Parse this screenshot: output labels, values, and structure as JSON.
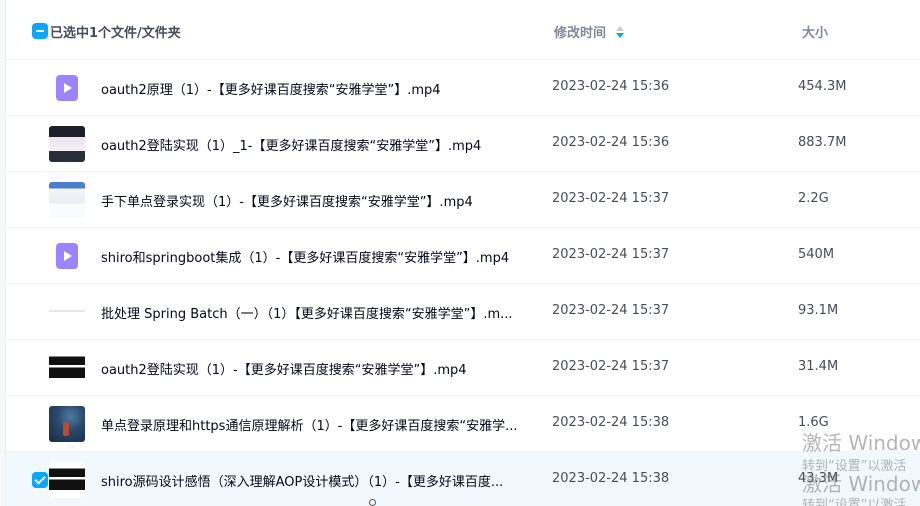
{
  "header": {
    "selected_label": "已选中1个文件/文件夹",
    "time_label": "修改时间",
    "size_label": "大小"
  },
  "rows": [
    {
      "name": "oauth2原理（1）-【更多好课百度搜索“安雅学堂”】.mp4",
      "time": "2023-02-24 15:36",
      "size": "454.3M",
      "thumb": "video-file-icon"
    },
    {
      "name": "oauth2登陆实现（1）_1-【更多好课百度搜索“安雅学堂”】.mp4",
      "time": "2023-02-24 15:36",
      "size": "883.7M",
      "thumb": "video-thumbnail"
    },
    {
      "name": "手下单点登录实现（1）-【更多好课百度搜索“安雅学堂”】.mp4",
      "time": "2023-02-24 15:37",
      "size": "2.2G",
      "thumb": "video-thumbnail"
    },
    {
      "name": "shiro和springboot集成（1）-【更多好课百度搜索“安雅学堂”】.mp4",
      "time": "2023-02-24 15:37",
      "size": "540M",
      "thumb": "video-file-icon"
    },
    {
      "name": "批处理 Spring Batch（一）（1）【更多好课百度搜索“安雅学堂”】.m...",
      "time": "2023-02-24 15:37",
      "size": "93.1M",
      "thumb": "video-thumbnail"
    },
    {
      "name": "oauth2登陆实现（1）-【更多好课百度搜索“安雅学堂”】.mp4",
      "time": "2023-02-24 15:37",
      "size": "31.4M",
      "thumb": "video-thumbnail"
    },
    {
      "name": "单点登录原理和https通信原理解析（1）-【更多好课百度搜索“安雅学...",
      "time": "2023-02-24 15:38",
      "size": "1.6G",
      "thumb": "video-thumbnail"
    },
    {
      "name": "shiro源码设计感悟（深入理解AOP设计模式）（1）-【更多好课百度...",
      "time": "2023-02-24 15:38",
      "size": "43.3M",
      "thumb": "video-thumbnail",
      "selected": true
    }
  ],
  "watermark": {
    "line1": "激活 Windows",
    "line2": "转到“设置”以激活",
    "line3": "激活 Windows",
    "line4": "转到“设置”以激活"
  },
  "colors": {
    "accent": "#06a7ff",
    "selected_row_bg": "#f1f9ff",
    "video_icon": "#9b84ff"
  }
}
